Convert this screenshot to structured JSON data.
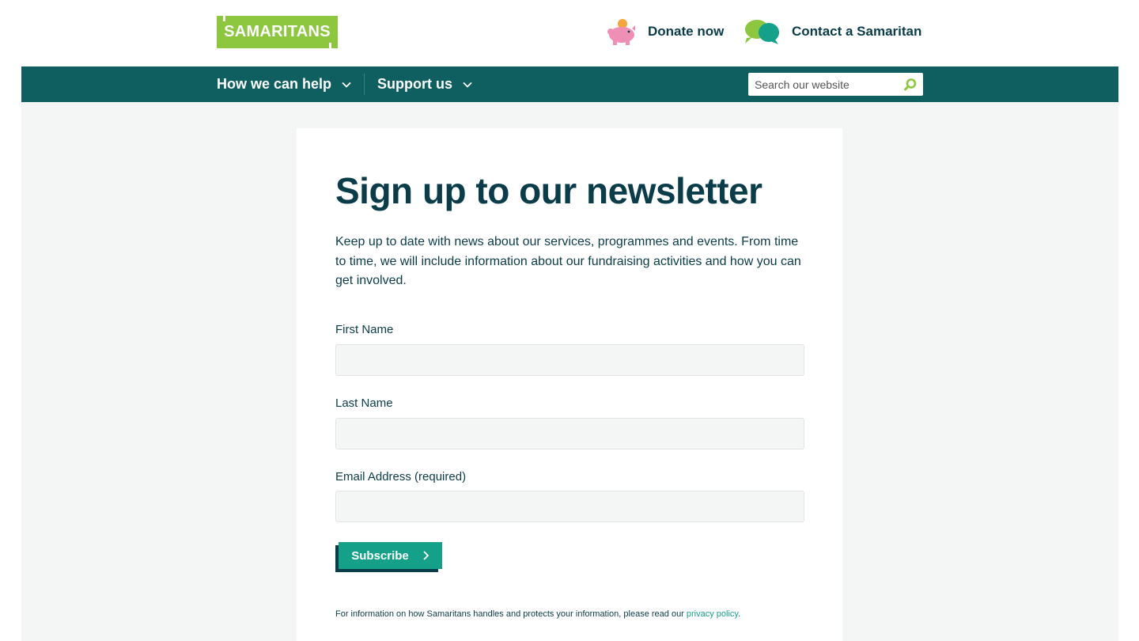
{
  "header": {
    "logo_text": "SAMARITANS",
    "donate_label": "Donate now",
    "contact_label": "Contact a Samaritan"
  },
  "nav": {
    "items": [
      {
        "label": "How we can help"
      },
      {
        "label": "Support us"
      }
    ],
    "search_placeholder": "Search our website"
  },
  "form": {
    "title": "Sign up to our newsletter",
    "intro": "Keep up to date with news about our services, programmes and events. From time to time, we will include information about our fundraising activities and how you can get involved.",
    "fields": [
      {
        "label": "First Name",
        "value": ""
      },
      {
        "label": "Last Name",
        "value": ""
      },
      {
        "label": "Email Address (required)",
        "value": ""
      }
    ],
    "subscribe_label": "Subscribe",
    "privacy_text": "For information on how Samaritans handles and protects your information, please read our ",
    "privacy_link": "privacy policy",
    "privacy_suffix": "."
  },
  "colors": {
    "brand_green": "#8dc63f",
    "nav_teal": "#0f5e60",
    "accent_teal": "#15a08a",
    "text_dark": "#0b3c49"
  },
  "icons": [
    "piggy-bank-icon",
    "speech-bubbles-icon",
    "chevron-down-icon",
    "search-icon",
    "chevron-right-icon"
  ]
}
